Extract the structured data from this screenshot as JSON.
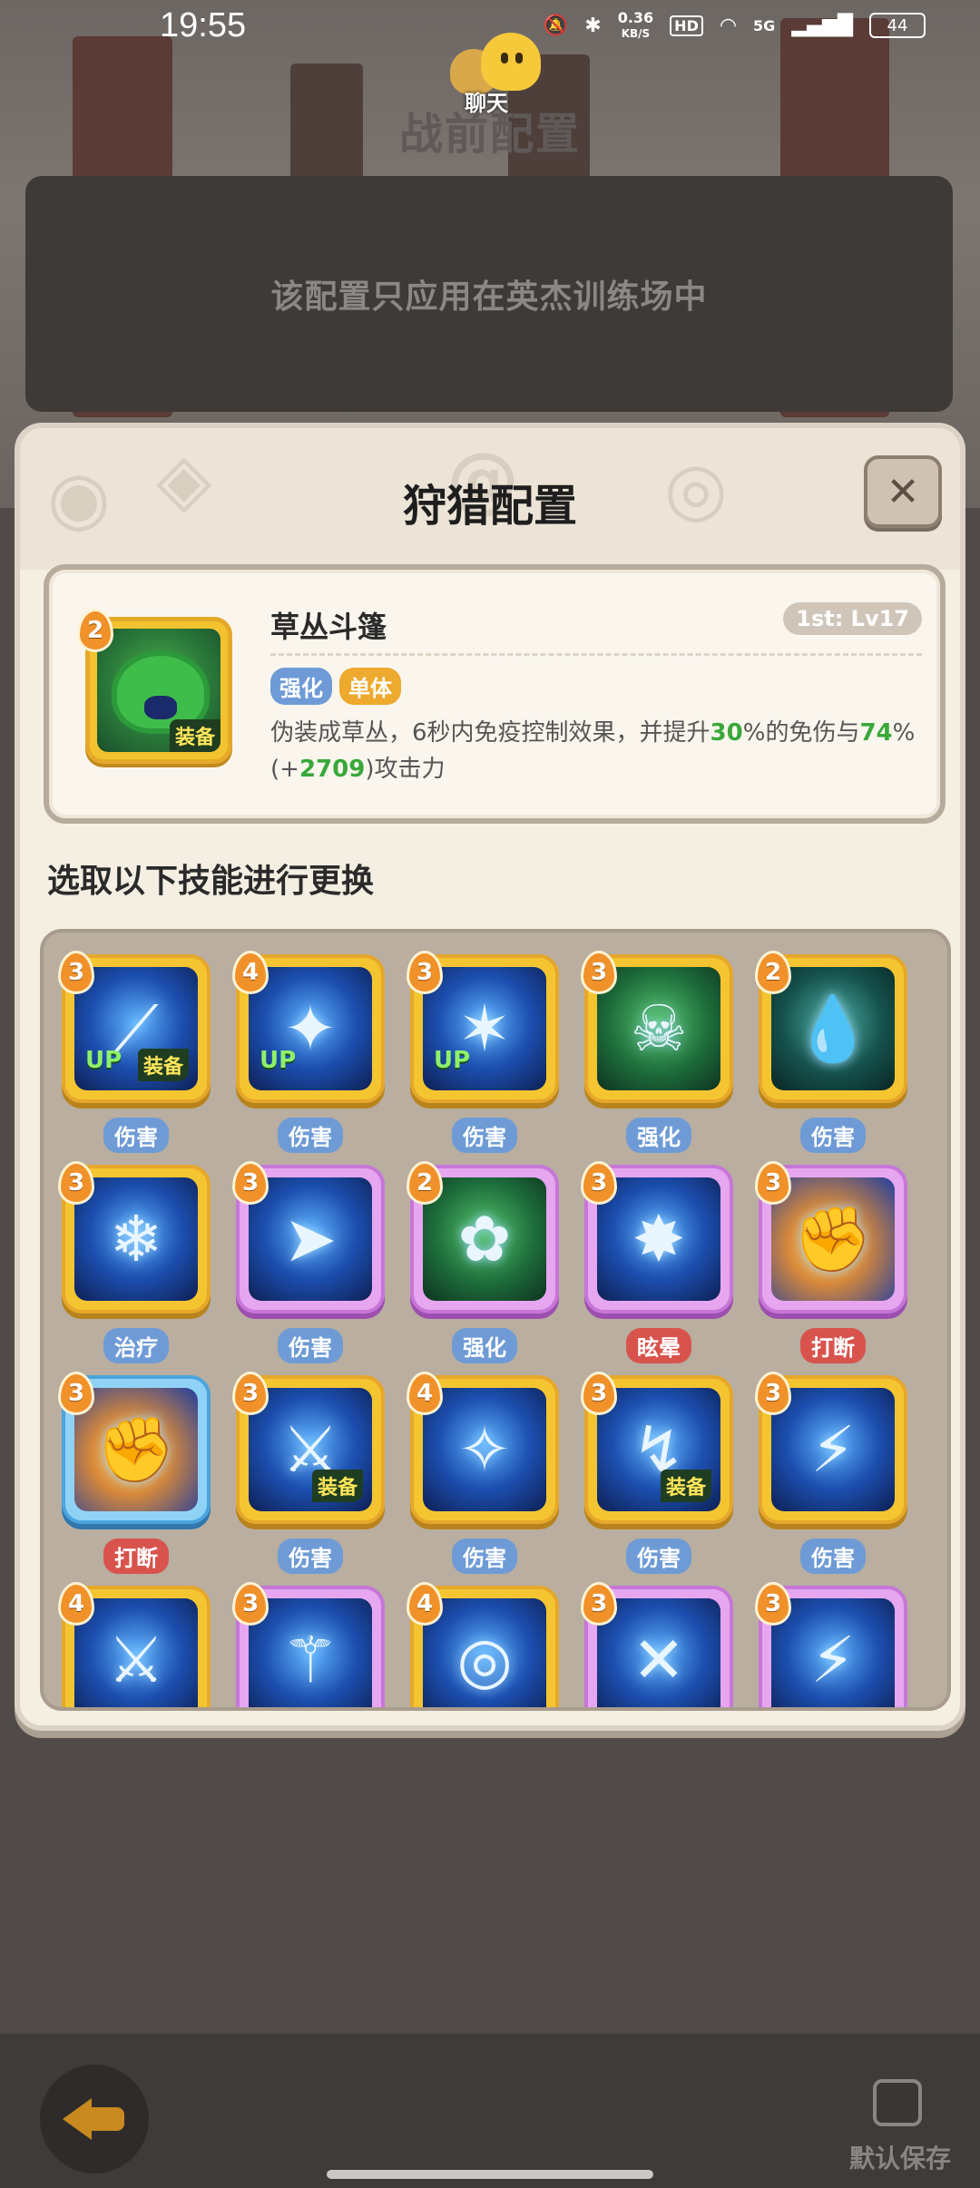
{
  "status_bar": {
    "time": "19:55",
    "net_speed_value": "0.36",
    "net_speed_unit": "KB/S",
    "hd": "HD",
    "signal": "5G",
    "battery": "44"
  },
  "chat": {
    "label": "聊天"
  },
  "page": {
    "title": "战前配置",
    "notice": "该配置只应用在英杰训练场中"
  },
  "modal": {
    "title": "狩猎配置",
    "close_label": "✕",
    "selected": {
      "level": "2",
      "name": "草丛斗篷",
      "rank": "1st: Lv17",
      "equip_tag": "装备",
      "tags": [
        "强化",
        "单体"
      ],
      "desc_part1": "伪装成草丛，6秒内免疫控制效果，并提升",
      "desc_val1": "30",
      "desc_part2": "%的免伤与",
      "desc_val2": "74",
      "desc_part3": "%",
      "desc_part4": "(+",
      "desc_val3": "2709",
      "desc_part5": ")攻击力"
    },
    "section_label": "选取以下技能进行更换",
    "skills": [
      {
        "level": "3",
        "category": "伤害",
        "up": "UP",
        "equip": "装备",
        "frame": "gold",
        "icon": "claw-slash"
      },
      {
        "level": "4",
        "category": "伤害",
        "up": "UP",
        "equip": "",
        "frame": "gold",
        "icon": "shadow-strike"
      },
      {
        "level": "3",
        "category": "伤害",
        "up": "UP",
        "equip": "",
        "frame": "gold",
        "icon": "blade-burst"
      },
      {
        "level": "3",
        "category": "强化",
        "up": "",
        "equip": "",
        "frame": "gold",
        "icon": "poison-skull"
      },
      {
        "level": "2",
        "category": "伤害",
        "up": "",
        "equip": "",
        "frame": "gold",
        "icon": "water-drop"
      },
      {
        "level": "3",
        "category": "治疗",
        "up": "",
        "equip": "",
        "frame": "gold",
        "icon": "frost-mask"
      },
      {
        "level": "3",
        "category": "伤害",
        "up": "",
        "equip": "",
        "frame": "purple",
        "icon": "spear-thrust"
      },
      {
        "level": "2",
        "category": "强化",
        "up": "",
        "equip": "",
        "frame": "purple",
        "icon": "bush-cloak"
      },
      {
        "level": "3",
        "category": "眩晕",
        "up": "",
        "equip": "",
        "frame": "purple",
        "icon": "stun-burst"
      },
      {
        "level": "3",
        "category": "打断",
        "up": "",
        "equip": "",
        "frame": "purple",
        "icon": "fist-punch"
      },
      {
        "level": "3",
        "category": "打断",
        "up": "",
        "equip": "",
        "frame": "cyan",
        "icon": "fist-punch"
      },
      {
        "level": "3",
        "category": "伤害",
        "up": "",
        "equip": "装备",
        "frame": "gold",
        "icon": "triple-daggers"
      },
      {
        "level": "4",
        "category": "伤害",
        "up": "",
        "equip": "",
        "frame": "gold",
        "icon": "star-orbit"
      },
      {
        "level": "3",
        "category": "伤害",
        "up": "",
        "equip": "装备",
        "frame": "gold",
        "icon": "dagger-rain"
      },
      {
        "level": "3",
        "category": "伤害",
        "up": "",
        "equip": "",
        "frame": "gold",
        "icon": "lightning-shock"
      },
      {
        "level": "4",
        "category": "",
        "up": "",
        "equip": "",
        "frame": "gold",
        "icon": "sword-slash"
      },
      {
        "level": "3",
        "category": "",
        "up": "",
        "equip": "",
        "frame": "purple",
        "icon": "bone-blade"
      },
      {
        "level": "4",
        "category": "",
        "up": "",
        "equip": "",
        "frame": "gold",
        "icon": "whirl-vortex"
      },
      {
        "level": "3",
        "category": "",
        "up": "",
        "equip": "",
        "frame": "purple",
        "icon": "blood-slash"
      },
      {
        "level": "3",
        "category": "",
        "up": "",
        "equip": "",
        "frame": "purple",
        "icon": "horn-lightning"
      }
    ]
  },
  "bottom": {
    "save_label": "默认保存"
  },
  "colors": {
    "accent_green": "#39a83a",
    "tag_blue": "#6e9bd6",
    "tag_orange": "#eeaa2e",
    "tag_red": "#d9534d",
    "frame_gold": "#f4c531",
    "frame_purple": "#e6a6f0",
    "frame_cyan": "#8fd2f6"
  }
}
